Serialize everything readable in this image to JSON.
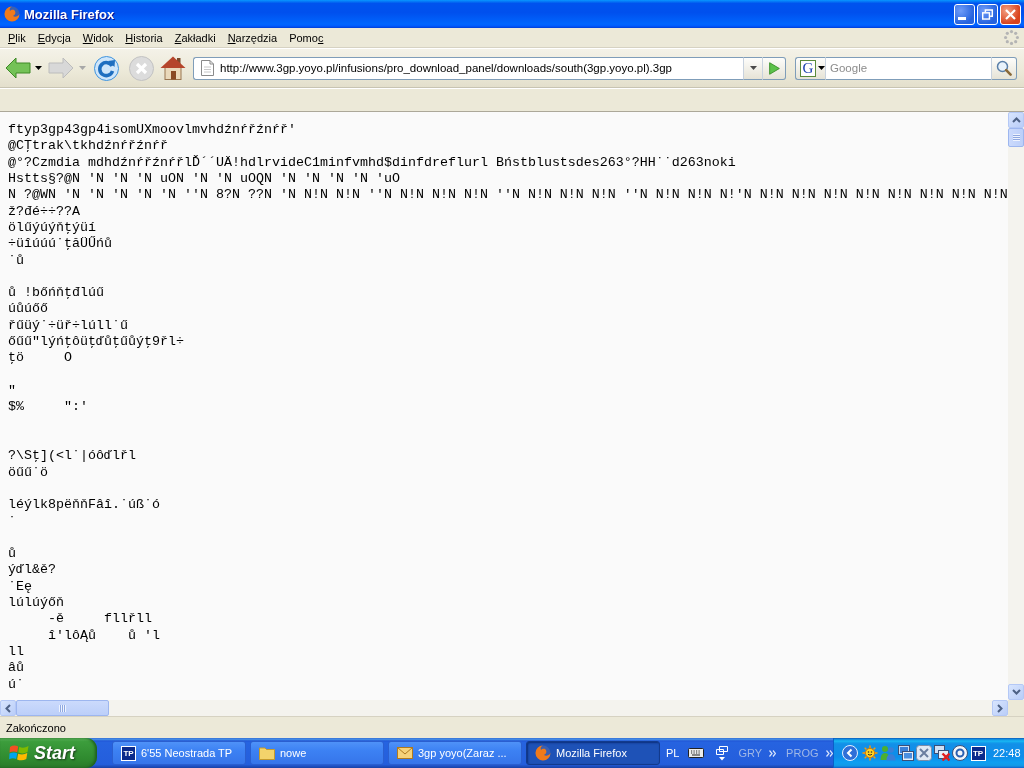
{
  "window": {
    "title": "Mozilla Firefox"
  },
  "menu_bar": {
    "items": [
      {
        "mnemonic": "P",
        "after": "lik"
      },
      {
        "mnemonic": "E",
        "after": "dycja"
      },
      {
        "mnemonic": "W",
        "after": "idok"
      },
      {
        "mnemonic": "H",
        "after": "istoria"
      },
      {
        "mnemonic": "Z",
        "after": "akładki"
      },
      {
        "mnemonic": "N",
        "after": "arzędzia"
      },
      {
        "before": "Pomo",
        "mnemonic": "c"
      }
    ]
  },
  "toolbar": {
    "buttons": [
      {
        "kind": "back",
        "disabled": false
      },
      {
        "kind": "history-menu",
        "disabled": false
      },
      {
        "kind": "forward",
        "disabled": true
      },
      {
        "kind": "history-menu",
        "disabled": true
      },
      {
        "kind": "reload",
        "disabled": false
      },
      {
        "kind": "stop",
        "disabled": true
      },
      {
        "kind": "home",
        "disabled": false
      }
    ]
  },
  "address_bar": {
    "value": "http://www.3gp.yoyo.pl/infusions/pro_download_panel/downloads/south(3gp.yoyo.pl).3gp"
  },
  "search_bar": {
    "engine_logo": "G",
    "placeholder": "Google"
  },
  "page": {
    "text": "ftyp3gp43gp4isomUXmoovlmvhdźnŕřźnŕř'\n@CŢtrak\\tkhdźnŕřźnŕř\n@°?Czmdia mdhdźnŕřźnŕřlĎ´´UÄ!hdlrvideC1minfvmhd$dinfdreflurl Bństblustsdes263°?HH˙˙d263noki\nHstts§?@N 'N 'N 'N uON 'N 'N uOQN 'N 'N 'N 'N 'uO\nN ?@WN 'N 'N 'N 'N 'N ''N 8?N ??N 'N N!N N!N ''N N!N N!N N!N ''N N!N N!N N!N ''N N!N N!N N!'N N!N N!N N!N N!N N!N N!N N!N N!N\nž?đé÷÷??A\nölűýúýňţýüí\n÷üîúúú˙ţăÜŰńů\n˙ů\n\nů !bőńňţđlúű\núůúőő\nřűüý˙÷üř÷lúll˙ű\nőűű\"lýńţôüţďůţűůýţ9řl÷\nţö     O\n\n\"\n$%     \":'\n\n\n?\\Sţ](<l˙|óôďlřl\nöűű˙ö\n\nléýlk8pëňňFâî.˙úß˙ó\n˙\n\nů\nýďl&ě?\n˙Eę\nlúlúýőň\n     -ě     fllřll\n     î'lôĄů    ů 'l\nll\nâů\nú˙"
  },
  "status_bar": {
    "text": "Zakończono"
  },
  "taskbar": {
    "start_label": "Start",
    "tasks": [
      {
        "kind": "logo",
        "logo_text": "TP",
        "label": "6'55 Neostrada TP",
        "selected": false
      },
      {
        "kind": "folder",
        "label": "nowe",
        "selected": false
      },
      {
        "kind": "mail",
        "label": "3gp yoyo(Zaraz ...",
        "selected": false
      },
      {
        "kind": "browser",
        "label": "Mozilla Firefox",
        "selected": true
      }
    ],
    "language": "PL",
    "toolbars": [
      {
        "label": "GRY"
      },
      {
        "label": "PROG"
      }
    ],
    "tray": {
      "logo_text": "TP",
      "time": "22:48"
    }
  }
}
